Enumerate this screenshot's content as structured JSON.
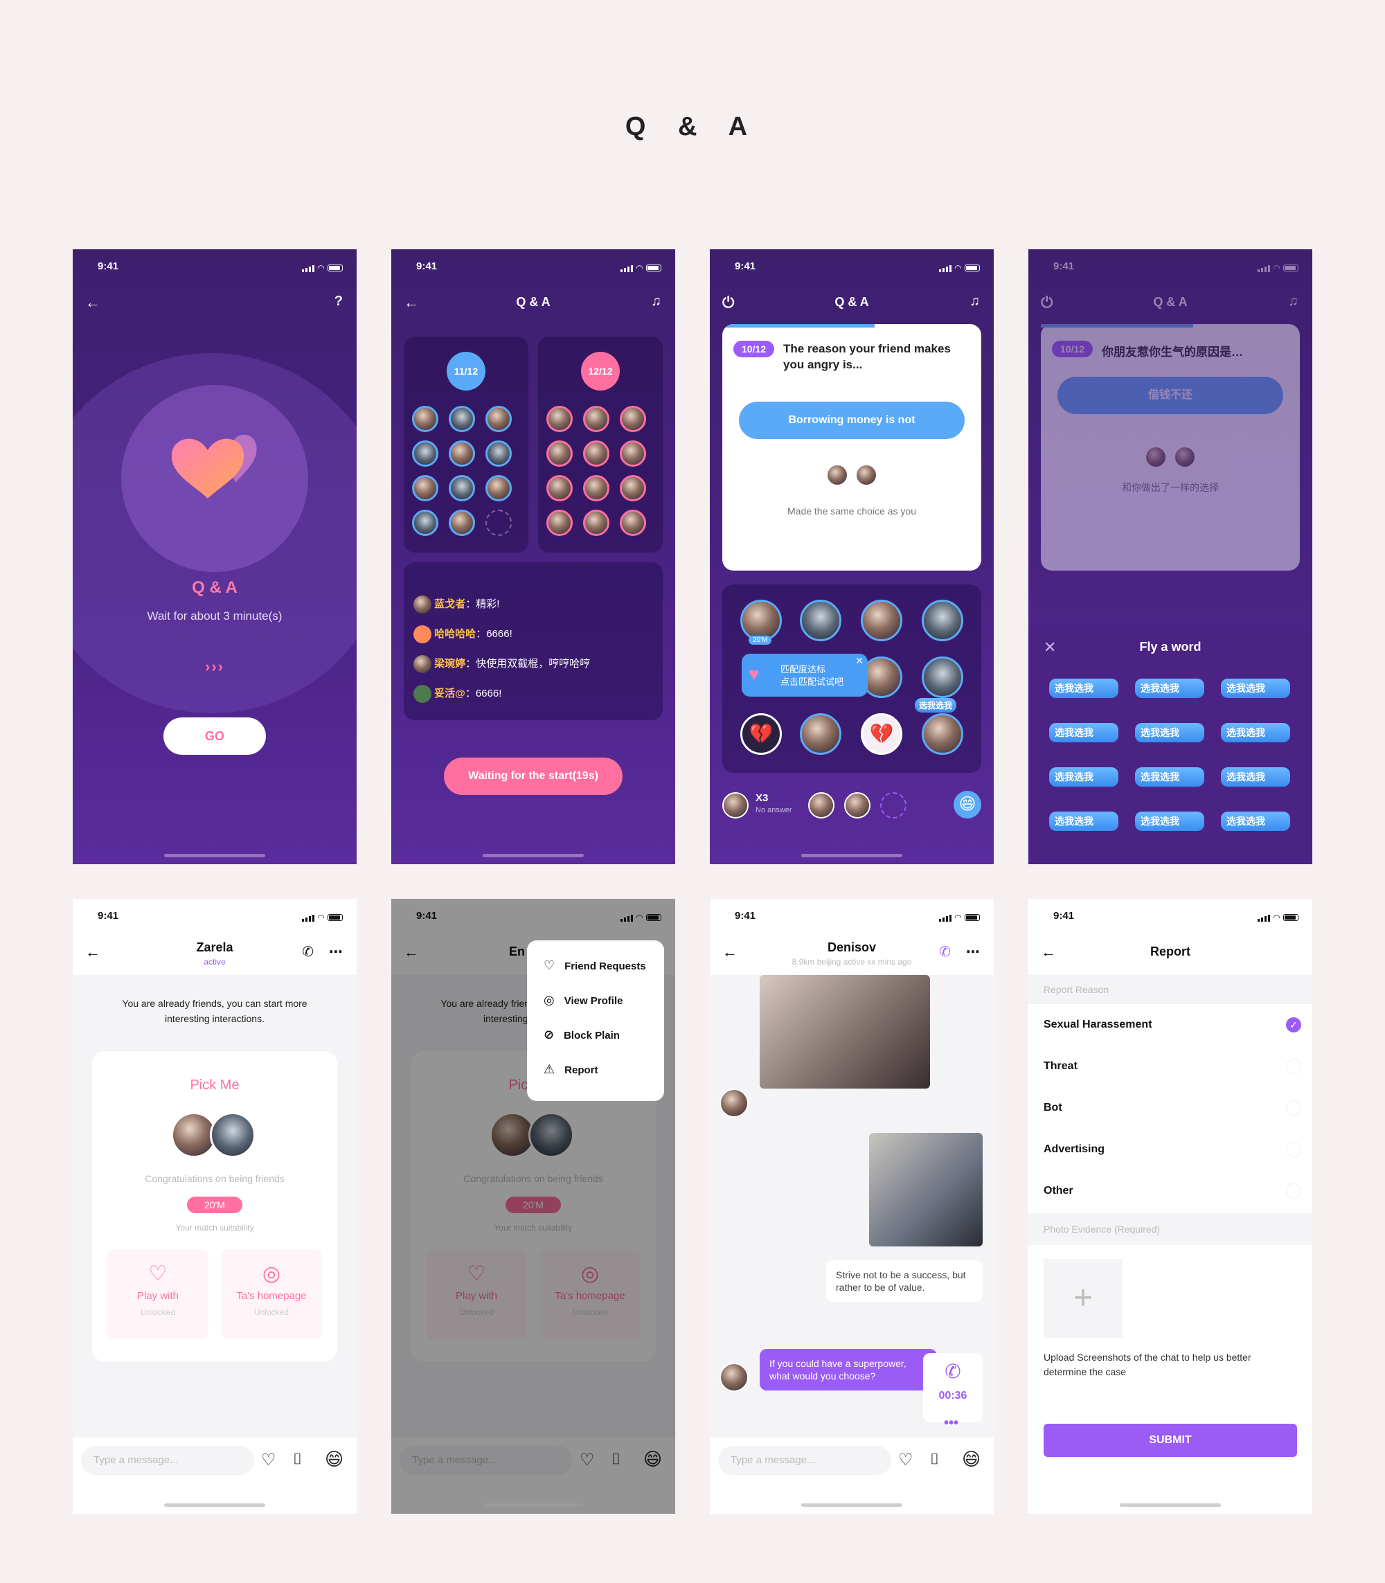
{
  "page_title": "Q & A",
  "status_time": "9:41",
  "screen1": {
    "title": "Q & A",
    "subtitle": "Wait for about 3 minute(s)",
    "go_label": "GO",
    "help_icon": "?",
    "progress_dots": "›››"
  },
  "screen2": {
    "title": "Q & A",
    "team_left_count": "11/12",
    "team_right_count": "12/12",
    "chat": [
      {
        "name": "蓝戈者",
        "text": "精彩!"
      },
      {
        "name": "哈哈哈哈",
        "text": "6666!"
      },
      {
        "name": "梁琬婷",
        "text": "快使用双截棍，哼哼哈哼"
      },
      {
        "name": "妥活@",
        "text": "6666!"
      }
    ],
    "wait_label": "Waiting for the start(19s)"
  },
  "screen3": {
    "title": "Q & A",
    "question_badge": "10/12",
    "question": "The reason your friend makes you angry is...",
    "answer": "Borrowing money is not",
    "same_choice": "Made the same choice as you",
    "popup_line1": "匹配度达标",
    "popup_line2": "点击匹配试试吧",
    "match_badge": "20'M",
    "pick_sticker": "选我选我",
    "bottom_multiplier": "X3",
    "bottom_no_answer": "No answer"
  },
  "screen4": {
    "title": "Q & A",
    "question_badge": "10/12",
    "question": "你朋友惹你生气的原因是…",
    "answer": "借钱不还",
    "same_choice": "和你做出了一样的选择",
    "sheet_title": "Fly a word",
    "stickers": [
      "选我选我",
      "选我选我",
      "选我选我",
      "选我选我",
      "选我选我",
      "选我选我",
      "选我选我",
      "选我选我",
      "选我选我",
      "选我选我",
      "选我选我",
      "选我选我"
    ]
  },
  "screen5": {
    "name": "Zarela",
    "status": "active",
    "info": "You are already friends, you can start more interesting interactions.",
    "card_title": "Pick Me",
    "congrats": "Congratulations on being friends",
    "match_badge": "20'M",
    "match_caption": "Your match suitability",
    "action1_label": "Play with",
    "action1_sub": "Unlocked",
    "action2_label": "Ta's homepage",
    "action2_sub": "Unlocked",
    "input_placeholder": "Type a message..."
  },
  "screen6": {
    "name_partial": "En",
    "info": "You are already friends, you can start more interesting interactions.",
    "card_title": "Pick Me",
    "congrats": "Congratulations on being friends",
    "match_badge": "20'M",
    "match_caption": "Your match suitability",
    "action1_label": "Play with",
    "action1_sub": "Unlocked",
    "action2_label": "Ta's homepage",
    "action2_sub": "Unlocked",
    "menu": [
      "Friend Requests",
      "View  Profile",
      "Block Plain",
      "Report"
    ],
    "input_placeholder": "Type a message..."
  },
  "screen7": {
    "name": "Denisov",
    "meta": "8.9km  beijing  active xx mins ago",
    "quote": "Strive not to be a success, but rather to be of value.",
    "question_bubble": "If you could have a superpower, what would you choose?",
    "call_time": "00:36",
    "input_placeholder": "Type a message..."
  },
  "screen8": {
    "title": "Report",
    "reason_header": "Report Reason",
    "reasons": [
      {
        "label": "Sexual Harassement",
        "checked": true
      },
      {
        "label": "Threat",
        "checked": false
      },
      {
        "label": "Bot",
        "checked": false
      },
      {
        "label": "Advertising",
        "checked": false
      },
      {
        "label": "Other",
        "checked": false
      }
    ],
    "evidence_header": "Photo Evidence (Required)",
    "upload_caption": "Upload Screenshots of the chat to help us better determine the case",
    "submit_label": "SUBMIT"
  },
  "colors": {
    "purple_bg": "#4a2384",
    "accent_pink": "#ff6fa0",
    "accent_blue": "#5aaaf7",
    "accent_violet": "#9b5cf6"
  }
}
